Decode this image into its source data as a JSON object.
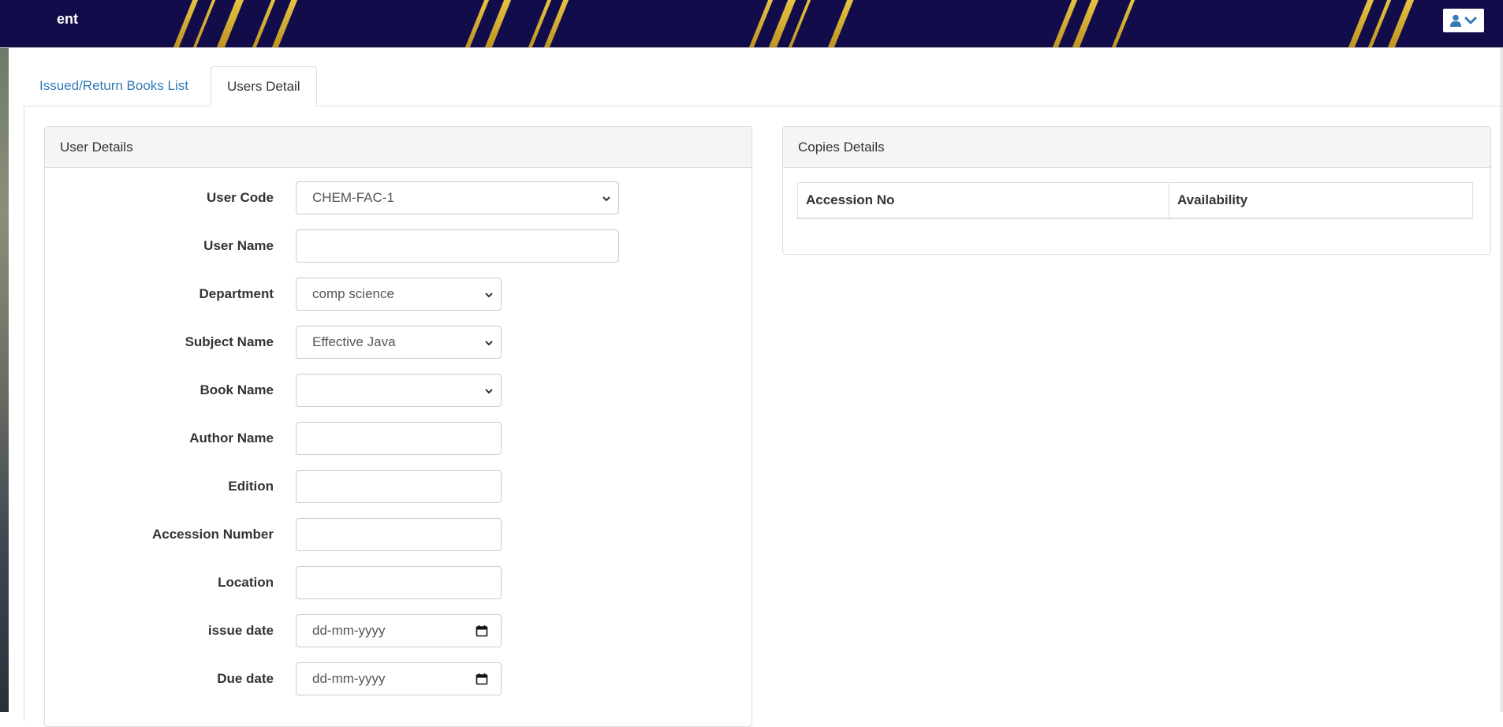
{
  "header": {
    "title": "ent",
    "user_menu_icons": [
      "user-icon",
      "chevron-down-icon"
    ],
    "colors": {
      "background": "#120c4a",
      "stripes": "#f2c531"
    }
  },
  "tabs": [
    {
      "label": "Issued/Return Books List",
      "active": false
    },
    {
      "label": "Users Detail",
      "active": true
    }
  ],
  "user_details": {
    "heading": "User Details",
    "fields": {
      "user_code": {
        "label": "User Code",
        "value": "CHEM-FAC-1"
      },
      "user_name": {
        "label": "User Name",
        "value": ""
      },
      "department": {
        "label": "Department",
        "value": "comp science"
      },
      "subject_name": {
        "label": "Subject Name",
        "value": "Effective Java"
      },
      "book_name": {
        "label": "Book Name",
        "value": ""
      },
      "author_name": {
        "label": "Author Name",
        "value": ""
      },
      "edition": {
        "label": "Edition",
        "value": ""
      },
      "accession_number": {
        "label": "Accession Number",
        "value": ""
      },
      "location": {
        "label": "Location",
        "value": ""
      },
      "issue_date": {
        "label": "issue date",
        "placeholder": "dd-mm-yyyy"
      },
      "due_date": {
        "label": "Due date",
        "placeholder": "dd-mm-yyyy"
      }
    }
  },
  "copies_details": {
    "heading": "Copies Details",
    "columns": [
      "Accession No",
      "Availability"
    ],
    "rows": []
  },
  "colors": {
    "link": "#337ab7",
    "panel_heading_bg": "#f5f5f5",
    "border": "#dddddd"
  }
}
